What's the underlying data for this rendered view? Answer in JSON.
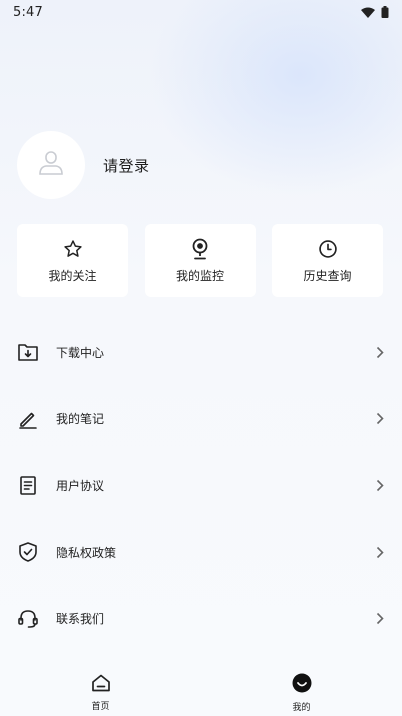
{
  "status_bar": {
    "time": "5:47",
    "icons": [
      "wifi-icon",
      "battery-icon"
    ]
  },
  "profile": {
    "avatar_icon": "user-icon",
    "login_label": "请登录"
  },
  "quick_actions": [
    {
      "label": "我的关注",
      "icon": "star-icon"
    },
    {
      "label": "我的监控",
      "icon": "webcam-icon"
    },
    {
      "label": "历史查询",
      "icon": "clock-icon"
    }
  ],
  "menu": [
    {
      "label": "下载中心",
      "icon": "download-folder-icon"
    },
    {
      "label": "我的笔记",
      "icon": "pencil-icon"
    },
    {
      "label": "用户协议",
      "icon": "document-icon"
    },
    {
      "label": "隐私权政策",
      "icon": "shield-check-icon"
    },
    {
      "label": "联系我们",
      "icon": "headset-icon"
    }
  ],
  "tabbar": [
    {
      "label": "首页",
      "icon": "home-icon"
    },
    {
      "label": "我的",
      "icon": "smile-icon",
      "active": true
    }
  ],
  "colors": {
    "background": "#f7f9fd",
    "card": "#ffffff",
    "text": "#222222",
    "accent_glow": "#dbe6fb"
  }
}
